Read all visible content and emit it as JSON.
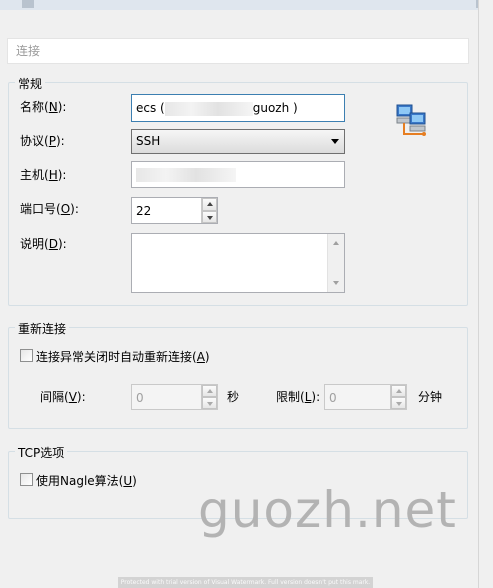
{
  "breadcrumb": {
    "text": "连接"
  },
  "general": {
    "legend": "常规",
    "name_label": "名称",
    "name_key": "N",
    "name_value_prefix": "ecs (",
    "name_value_suffix": "guozh )",
    "protocol_label": "协议",
    "protocol_key": "P",
    "protocol_value": "SSH",
    "host_label": "主机",
    "host_key": "H",
    "port_label": "端口号",
    "port_key": "O",
    "port_value": "22",
    "desc_label": "说明",
    "desc_key": "D",
    "icon": "network-computers-icon"
  },
  "reconnect": {
    "legend": "重新连接",
    "checkbox_label": "连接异常关闭时自动重新连接",
    "checkbox_key": "A",
    "checked": false,
    "interval_label": "间隔",
    "interval_key": "V",
    "interval_value": "0",
    "interval_unit": "秒",
    "limit_label": "限制",
    "limit_key": "L",
    "limit_value": "0",
    "limit_unit": "分钟"
  },
  "tcp": {
    "legend": "TCP选项",
    "nagle_label": "使用Nagle算法",
    "nagle_key": "U",
    "nagle_checked": false
  },
  "watermark": "guozh.net",
  "footer": "Protected with trial version of Visual Watermark. Full version doesn't put this mark."
}
